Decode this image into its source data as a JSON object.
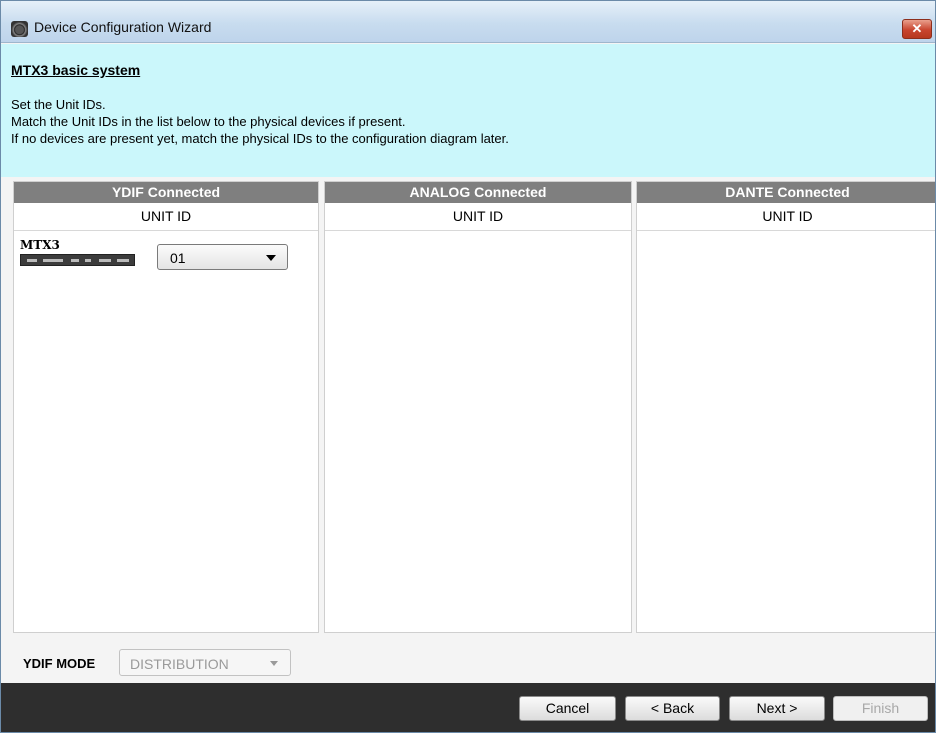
{
  "window": {
    "title": "Device Configuration Wizard",
    "close_label": "✕"
  },
  "header": {
    "heading": "MTX3 basic system",
    "lines": [
      "Set the Unit IDs.",
      "Match the Unit IDs in the list below to the physical devices if present.",
      "If no devices are present yet, match the physical IDs to the configuration diagram later."
    ]
  },
  "columns": [
    {
      "title": "YDIF Connected",
      "subtitle": "UNIT ID"
    },
    {
      "title": "ANALOG Connected",
      "subtitle": "UNIT ID"
    },
    {
      "title": "DANTE Connected",
      "subtitle": "UNIT ID"
    }
  ],
  "device": {
    "name": "MTX3",
    "unit_id": "01"
  },
  "ydif_mode": {
    "label": "YDIF MODE",
    "value": "DISTRIBUTION"
  },
  "buttons": {
    "cancel": "Cancel",
    "back": "< Back",
    "next": "Next >",
    "finish": "Finish"
  }
}
